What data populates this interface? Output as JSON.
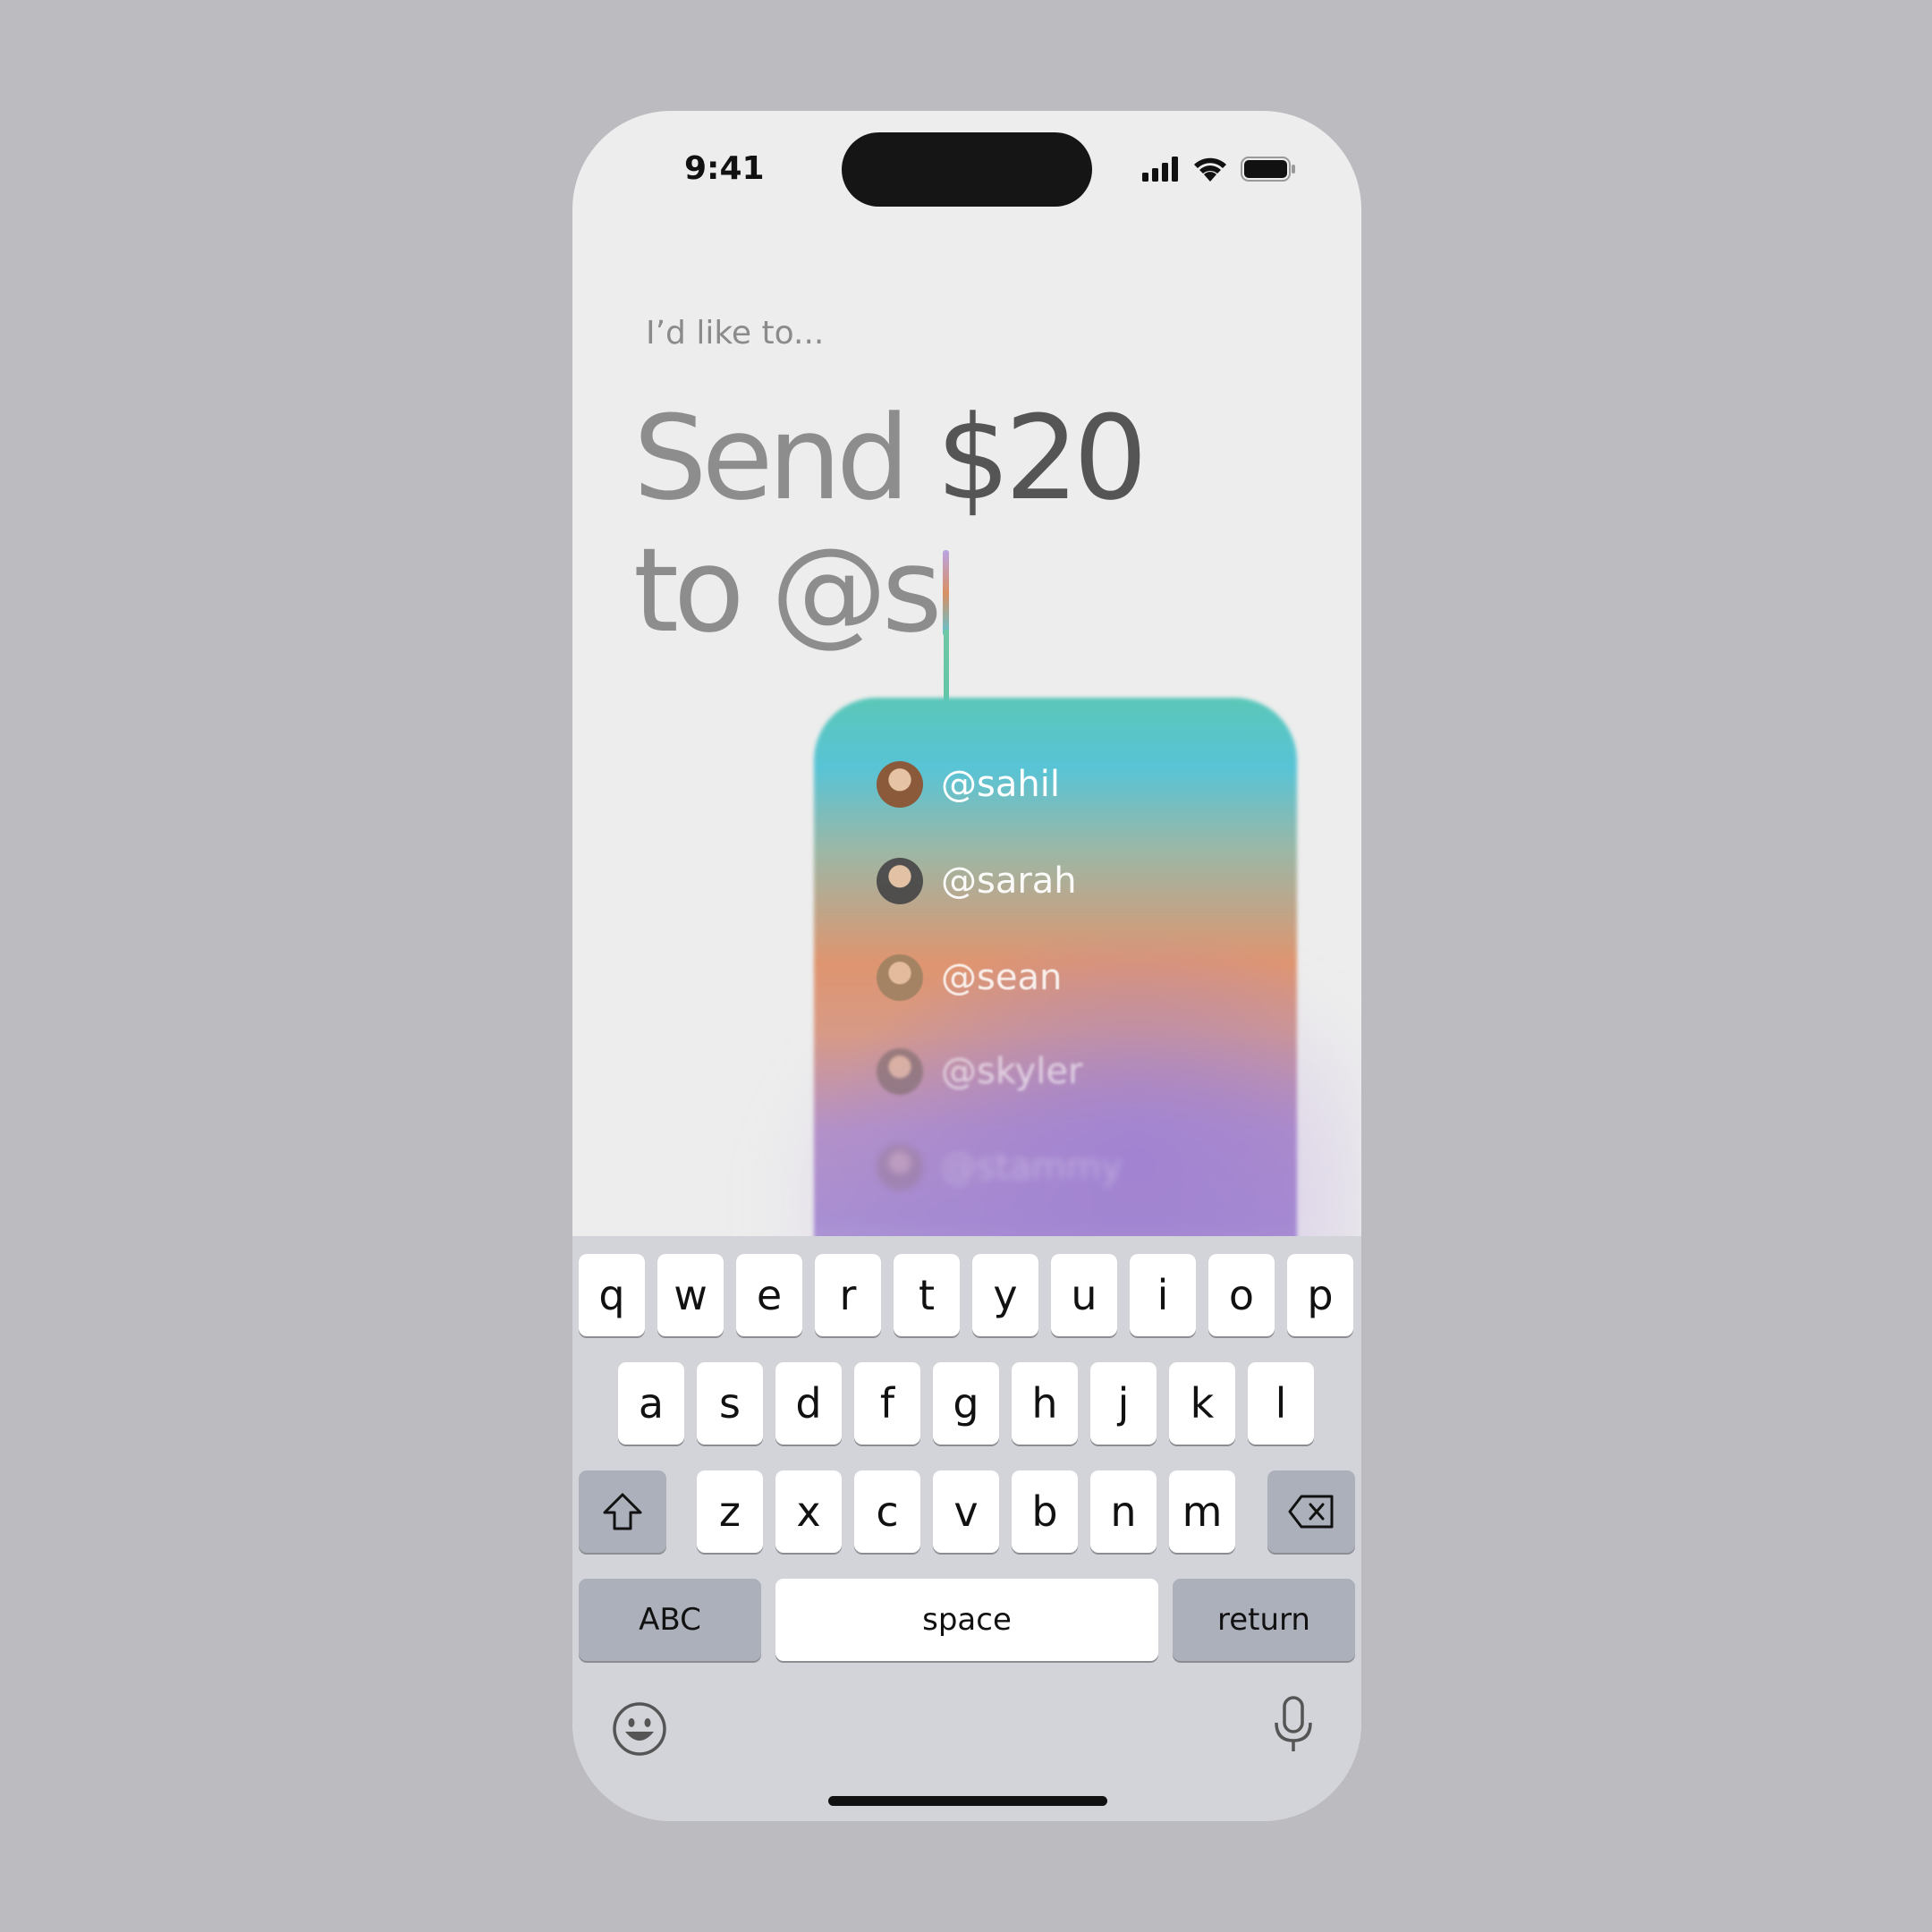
{
  "status": {
    "time": "9:41"
  },
  "prompt": "I’d like to...",
  "headline": {
    "word_send": "Send",
    "amount": "$20",
    "word_to": "to",
    "mention": "@s"
  },
  "suggestions": [
    {
      "handle": "@sahil",
      "avatar_color": "#8a5a3a",
      "opacity": 1
    },
    {
      "handle": "@sarah",
      "avatar_color": "#4a4a4a",
      "opacity": 0.95
    },
    {
      "handle": "@sean",
      "avatar_color": "#9a8060",
      "opacity": 0.85
    },
    {
      "handle": "@skyler",
      "avatar_color": "#7a6a6a",
      "opacity": 0.6
    },
    {
      "handle": "@stammy",
      "avatar_color": "#8a7070",
      "opacity": 0.3
    }
  ],
  "keyboard": {
    "row1": [
      "q",
      "w",
      "e",
      "r",
      "t",
      "y",
      "u",
      "i",
      "o",
      "p"
    ],
    "row2": [
      "a",
      "s",
      "d",
      "f",
      "g",
      "h",
      "j",
      "k",
      "l"
    ],
    "row3": [
      "z",
      "x",
      "c",
      "v",
      "b",
      "n",
      "m"
    ],
    "abc": "ABC",
    "space": "space",
    "return": "return"
  },
  "colors": {
    "background": "#bcbbc0",
    "screen": "#ededed",
    "keyboard": "#d3d4d9",
    "func_key": "#abb0ba"
  }
}
